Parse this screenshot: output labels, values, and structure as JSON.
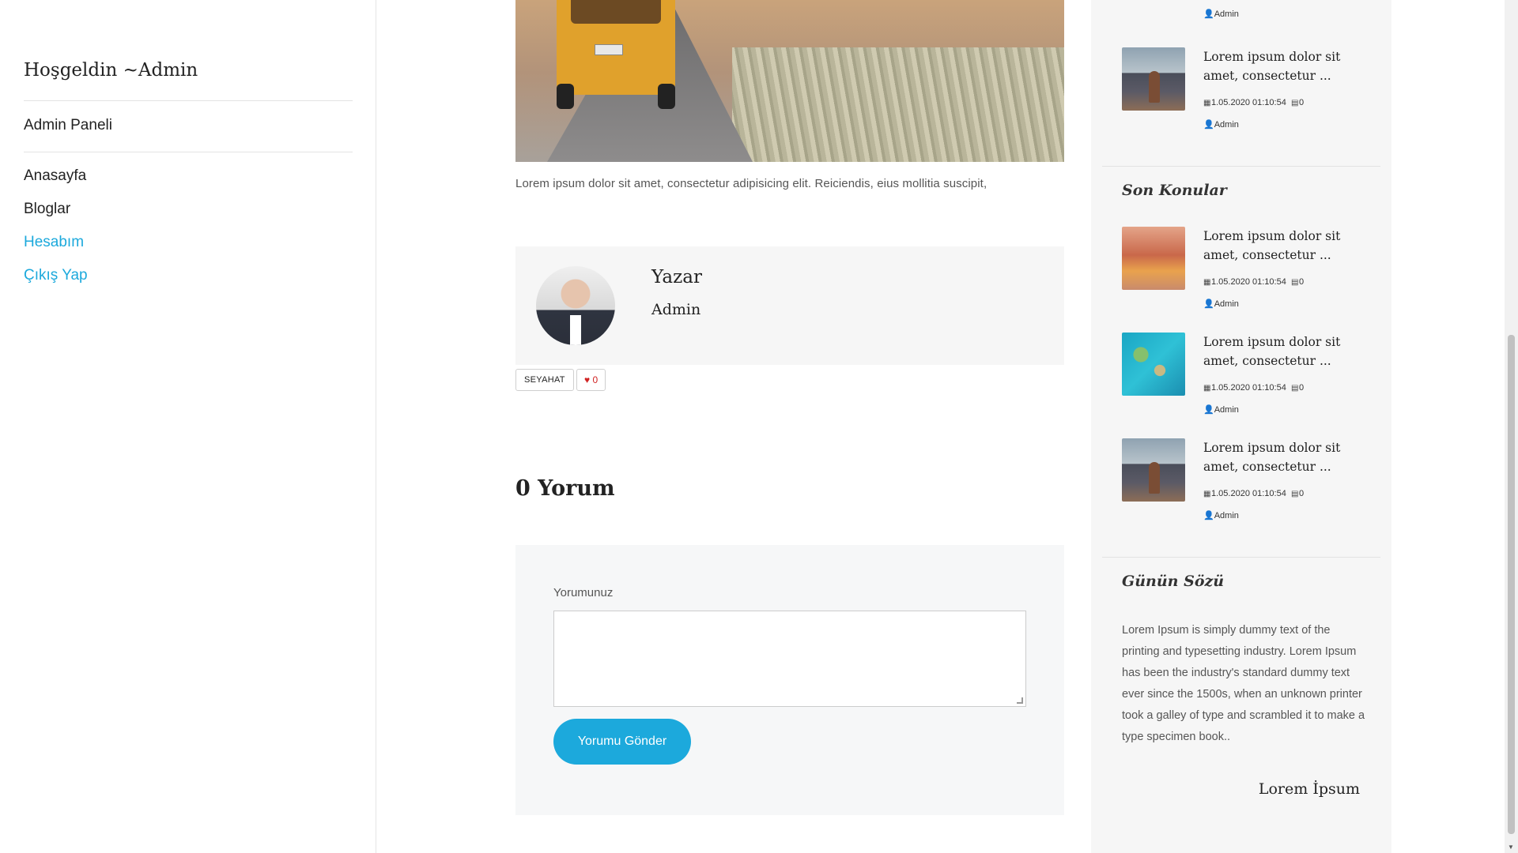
{
  "sidebar": {
    "welcome": "Hoşgeldin ~Admin",
    "admin_panel": "Admin Paneli",
    "nav": [
      {
        "label": "Anasayfa"
      },
      {
        "label": "Bloglar"
      },
      {
        "label": "Hesabım"
      },
      {
        "label": "Çıkış Yap"
      }
    ]
  },
  "article": {
    "excerpt": "Lorem ipsum dolor sit amet, consectetur adipisicing elit. Reiciendis, eius mollitia suscipit,",
    "author_title": "Yazar",
    "author_name": "Admin",
    "tag": "SEYAHAT",
    "likes": "0"
  },
  "comments": {
    "count_label": "0 Yorum",
    "form_label": "Yorumunuz",
    "textarea_value": "",
    "submit_label": "Yorumu Gönder"
  },
  "right_sidebar": {
    "top_partial_post": {
      "author": "Admin"
    },
    "popular_post": {
      "title": "Lorem ipsum dolor sit amet, consectetur ...",
      "date": "1.05.2020 01:10:54",
      "comments": "0",
      "author": "Admin"
    },
    "recent_title": "Son Konular",
    "recent_posts": [
      {
        "title": "Lorem ipsum dolor sit amet, consectetur ...",
        "date": "1.05.2020 01:10:54",
        "comments": "0",
        "author": "Admin"
      },
      {
        "title": "Lorem ipsum dolor sit amet, consectetur ...",
        "date": "1.05.2020 01:10:54",
        "comments": "0",
        "author": "Admin"
      },
      {
        "title": "Lorem ipsum dolor sit amet, consectetur ...",
        "date": "1.05.2020 01:10:54",
        "comments": "0",
        "author": "Admin"
      }
    ],
    "quote_title": "Günün Sözü",
    "quote_text": "Lorem Ipsum is simply dummy text of the printing and typesetting industry. Lorem Ipsum has been the industry's standard dummy text ever since the 1500s, when an unknown printer took a galley of type and scrambled it to make a type specimen book..",
    "quote_author": "Lorem İpsum"
  },
  "colors": {
    "accent": "#1ca9dc",
    "like": "#d02222"
  }
}
